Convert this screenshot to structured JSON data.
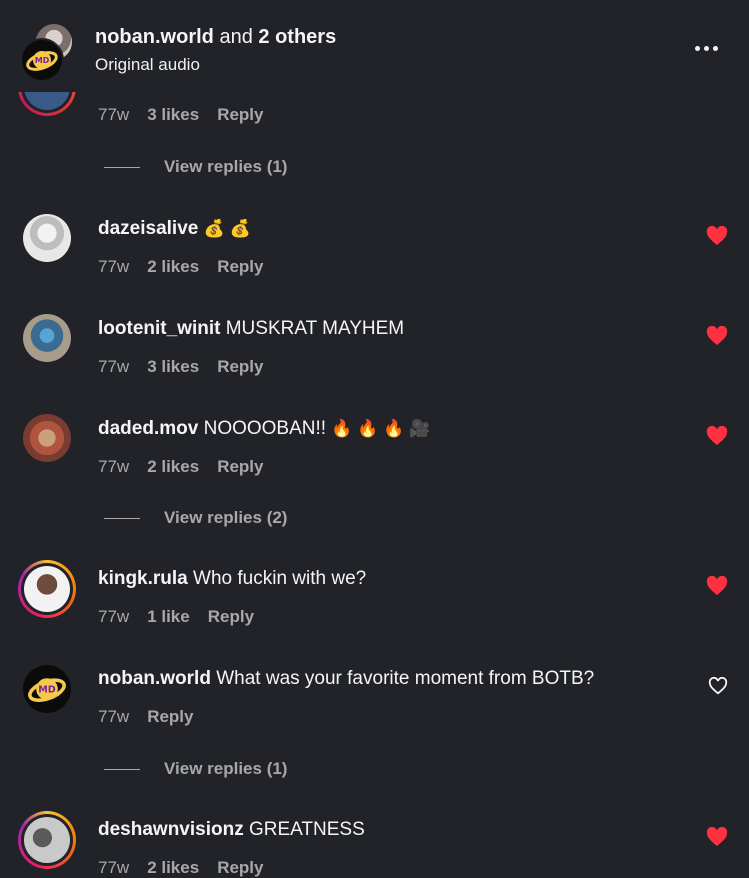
{
  "header": {
    "user": "noban.world",
    "and_text": "and",
    "others": "2 others",
    "subtitle": "Original audio"
  },
  "top_meta": {
    "time": "77w",
    "likes": "3 likes",
    "reply": "Reply"
  },
  "view_replies_1": "View replies (1)",
  "comments": [
    {
      "user": "dazeisalive",
      "text": "",
      "emoji": "💰 💰",
      "time": "77w",
      "likes": "2 likes",
      "reply": "Reply",
      "liked": true
    },
    {
      "user": "lootenit_winit",
      "text": "MUSKRAT MAYHEM",
      "emoji": "",
      "time": "77w",
      "likes": "3 likes",
      "reply": "Reply",
      "liked": true
    },
    {
      "user": "daded.mov",
      "text": "NOOOOBAN!!",
      "emoji": "🔥 🔥 🔥 🎥",
      "time": "77w",
      "likes": "2 likes",
      "reply": "Reply",
      "liked": true
    },
    {
      "user": "kingk.rula",
      "text": "Who fuckin with we?",
      "emoji": "",
      "time": "77w",
      "likes": "1 like",
      "reply": "Reply",
      "liked": true
    },
    {
      "user": "noban.world",
      "text": "What was your favorite moment from BOTB?",
      "emoji": "",
      "time": "77w",
      "likes": "",
      "reply": "Reply",
      "liked": false
    },
    {
      "user": "deshawnvisionz",
      "text": "GREATNESS",
      "emoji": "",
      "time": "77w",
      "likes": "2 likes",
      "reply": "Reply",
      "liked": true
    }
  ],
  "view_replies_2": "View replies (2)",
  "view_replies_3": "View replies (1)",
  "colors": {
    "background": "#212328",
    "heart_red": "#ff3040",
    "muted": "#a8a8a8"
  }
}
